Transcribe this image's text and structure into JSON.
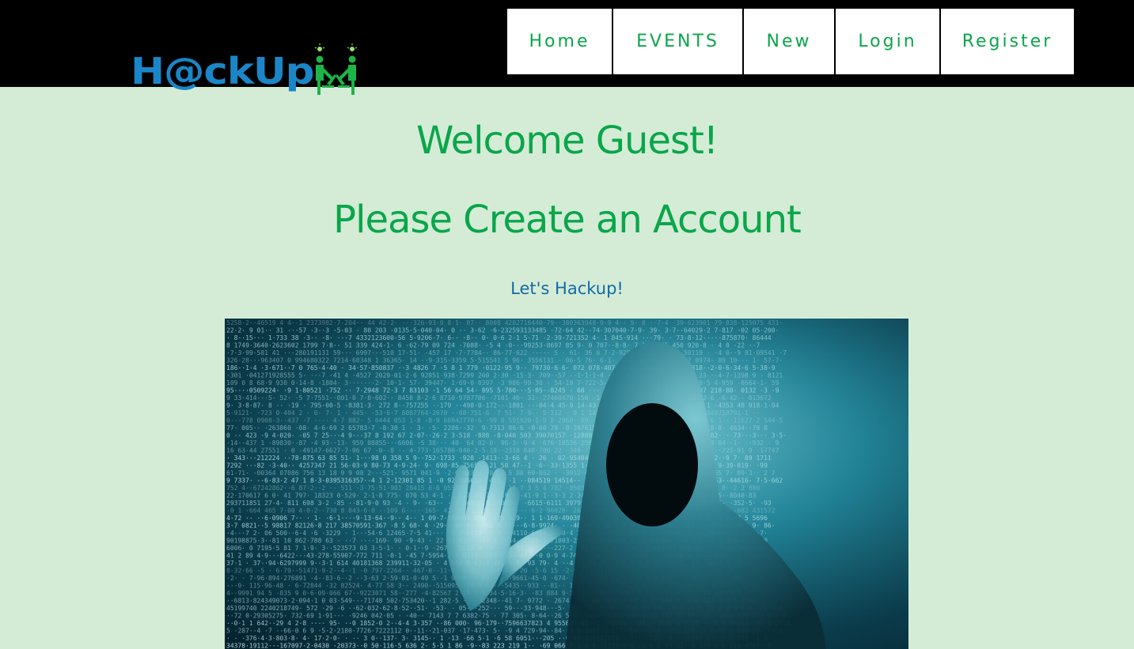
{
  "logo": {
    "text": "H@ckUp"
  },
  "nav": {
    "items": [
      {
        "label": "Home"
      },
      {
        "label": "EVENTS"
      },
      {
        "label": "New"
      },
      {
        "label": "Login"
      },
      {
        "label": "Register"
      }
    ]
  },
  "main": {
    "welcome": "Welcome Guest!",
    "cta": "Please Create an Account",
    "tagline": "Let's Hackup!"
  },
  "colors": {
    "background": "#d4ecd6",
    "header": "#000000",
    "accent_green": "#0aa64a",
    "accent_blue": "#126aa6"
  }
}
